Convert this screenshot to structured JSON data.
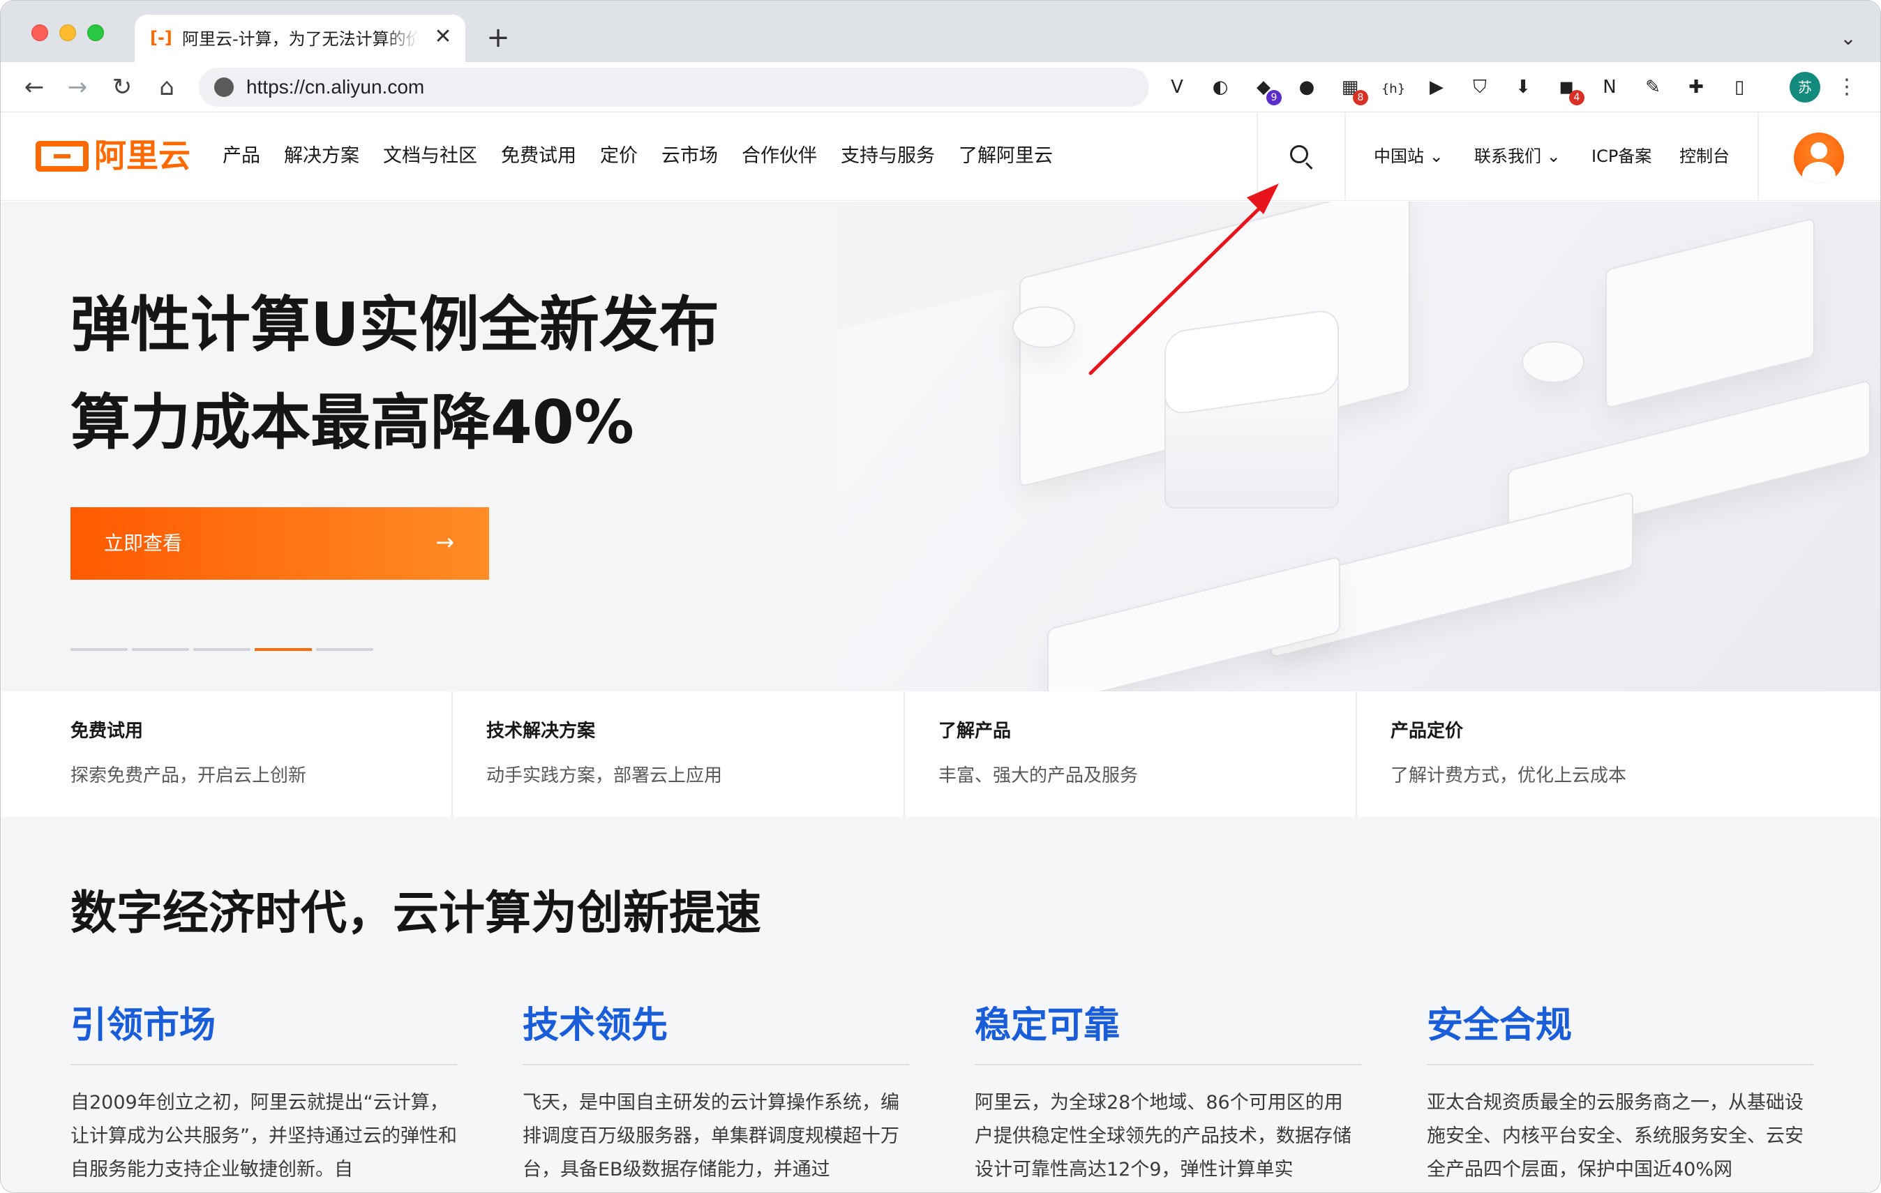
{
  "browser": {
    "tab": {
      "title": "阿里云-计算，为了无法计算的价值",
      "close": "✕"
    },
    "new_tab": "+",
    "tab_menu": "⌄",
    "nav": {
      "back": "←",
      "forward": "→",
      "reload": "↻",
      "home": "⌂"
    },
    "url": "https://cn.aliyun.com",
    "extensions": [
      {
        "name": "vimium-icon",
        "glyph": "V",
        "badge": ""
      },
      {
        "name": "password-icon",
        "glyph": "◐",
        "badge": ""
      },
      {
        "name": "graduation-icon",
        "glyph": "◆",
        "badge": "9"
      },
      {
        "name": "firefox-icon",
        "glyph": "●",
        "badge": ""
      },
      {
        "name": "grid-extension-icon",
        "glyph": "▦",
        "badge": "8"
      },
      {
        "name": "hashtag-extension-icon",
        "glyph": "{h}",
        "badge": ""
      },
      {
        "name": "play-icon",
        "glyph": "▶",
        "badge": ""
      },
      {
        "name": "shield-extension-icon",
        "glyph": "⛉",
        "badge": ""
      },
      {
        "name": "download-extension-icon",
        "glyph": "⬇",
        "badge": ""
      },
      {
        "name": "mask-extension-icon",
        "glyph": "◼",
        "badge": "4"
      },
      {
        "name": "notion-icon",
        "glyph": "N",
        "badge": ""
      },
      {
        "name": "note-extension-icon",
        "glyph": "✎",
        "badge": ""
      },
      {
        "name": "puzzle-icon",
        "glyph": "✚",
        "badge": ""
      },
      {
        "name": "sidepanel-icon",
        "glyph": "▯",
        "badge": ""
      }
    ],
    "profile_initial": "苏",
    "menu": "⋮"
  },
  "site": {
    "logo_text": "阿里云",
    "nav": [
      "产品",
      "解决方案",
      "文档与社区",
      "免费试用",
      "定价",
      "云市场",
      "合作伙伴",
      "支持与服务",
      "了解阿里云"
    ],
    "right_nav": {
      "region": "中国站",
      "contact": "联系我们",
      "icp": "ICP备案",
      "console": "控制台"
    }
  },
  "hero": {
    "title_line1": "弹性计算U实例全新发布",
    "title_line2": "算力成本最高降40%",
    "cta_label": "立即查看",
    "cta_arrow": "→",
    "carousel_active_index": 3,
    "carousel_count": 5
  },
  "cards": [
    {
      "title": "免费试用",
      "desc": "探索免费产品，开启云上创新"
    },
    {
      "title": "技术解决方案",
      "desc": "动手实践方案，部署云上应用"
    },
    {
      "title": "了解产品",
      "desc": "丰富、强大的产品及服务"
    },
    {
      "title": "产品定价",
      "desc": "了解计费方式，优化上云成本"
    }
  ],
  "section": {
    "title": "数字经济时代，云计算为创新提速",
    "pillars": [
      {
        "title": "引领市场",
        "text": "自2009年创立之初，阿里云就提出“云计算，让计算成为公共服务”，并坚持通过云的弹性和自服务能力支持企业敏捷创新。自"
      },
      {
        "title": "技术领先",
        "text": "飞天，是中国自主研发的云计算操作系统，编排调度百万级服务器，单集群调度规模超十万台，具备EB级数据存储能力，并通过"
      },
      {
        "title": "稳定可靠",
        "text": "阿里云，为全球28个地域、86个可用区的用户提供稳定性全球领先的产品技术，数据存储设计可靠性高达12个9，弹性计算单实"
      },
      {
        "title": "安全合规",
        "text": "亚太合规资质最全的云服务商之一，从基础设施安全、内核平台安全、系统服务安全、云安全产品四个层面，保护中国近40%网"
      }
    ]
  },
  "colors": {
    "brand": "#ff6a00",
    "pillar_title": "#1a5dd8",
    "annotation_arrow": "#e8141b"
  }
}
